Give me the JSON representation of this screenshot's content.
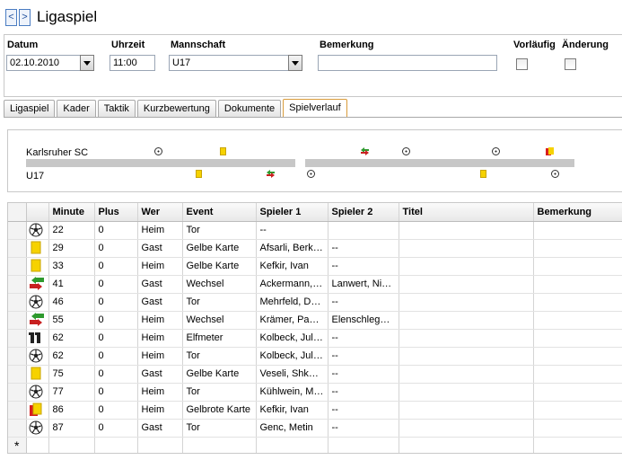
{
  "header": {
    "prev_label": "<",
    "next_label": ">",
    "title": "Ligaspiel"
  },
  "filters": {
    "datum_label": "Datum",
    "datum_value": "02.10.2010",
    "uhrzeit_label": "Uhrzeit",
    "uhrzeit_value": "11:00",
    "mannschaft_label": "Mannschaft",
    "mannschaft_value": "U17",
    "bemerkung_label": "Bemerkung",
    "bemerkung_value": "",
    "vorlaeufig_label": "Vorläufig",
    "aenderung_label": "Änderung"
  },
  "tabs": [
    {
      "label": "Ligaspiel",
      "active": false
    },
    {
      "label": "Kader",
      "active": false
    },
    {
      "label": "Taktik",
      "active": false
    },
    {
      "label": "Kurzbewertung",
      "active": false
    },
    {
      "label": "Dokumente",
      "active": false
    },
    {
      "label": "Spielverlauf",
      "active": true
    }
  ],
  "timeline": {
    "home_team": "Karlsruher SC",
    "away_team": "U17"
  },
  "table": {
    "columns": [
      "Minute",
      "Plus",
      "Wer",
      "Event",
      "Spieler 1",
      "Spieler 2",
      "Titel",
      "Bemerkung"
    ],
    "rows": [
      {
        "icon": "soccer-ball-icon",
        "minute": "22",
        "plus": "0",
        "wer": "Heim",
        "event": "Tor",
        "spieler1": "--",
        "spieler2": "",
        "titel": "",
        "bemerkung": ""
      },
      {
        "icon": "yellow-card-icon",
        "minute": "29",
        "plus": "0",
        "wer": "Gast",
        "event": "Gelbe Karte",
        "spieler1": "Afsarli, Berkan",
        "spieler2": "--",
        "titel": "",
        "bemerkung": ""
      },
      {
        "icon": "yellow-card-icon",
        "minute": "33",
        "plus": "0",
        "wer": "Heim",
        "event": "Gelbe Karte",
        "spieler1": "Kefkir, Ivan",
        "spieler2": "--",
        "titel": "",
        "bemerkung": ""
      },
      {
        "icon": "substitution-icon",
        "minute": "41",
        "plus": "0",
        "wer": "Gast",
        "event": "Wechsel",
        "spieler1": "Ackermann, J...",
        "spieler2": "Lanwert, Nic...",
        "titel": "",
        "bemerkung": ""
      },
      {
        "icon": "soccer-ball-icon",
        "minute": "46",
        "plus": "0",
        "wer": "Gast",
        "event": "Tor",
        "spieler1": "Mehrfeld, Dan...",
        "spieler2": "--",
        "titel": "",
        "bemerkung": ""
      },
      {
        "icon": "substitution-icon",
        "minute": "55",
        "plus": "0",
        "wer": "Heim",
        "event": "Wechsel",
        "spieler1": "Krämer, Pascal",
        "spieler2": "Elenschleger,...",
        "titel": "",
        "bemerkung": ""
      },
      {
        "icon": "penalty-11-icon",
        "minute": "62",
        "plus": "0",
        "wer": "Heim",
        "event": "Elfmeter",
        "spieler1": "Kolbeck, Julian",
        "spieler2": "--",
        "titel": "",
        "bemerkung": ""
      },
      {
        "icon": "soccer-ball-icon",
        "minute": "62",
        "plus": "0",
        "wer": "Heim",
        "event": "Tor",
        "spieler1": "Kolbeck, Julian",
        "spieler2": "--",
        "titel": "",
        "bemerkung": ""
      },
      {
        "icon": "yellow-card-icon",
        "minute": "75",
        "plus": "0",
        "wer": "Gast",
        "event": "Gelbe Karte",
        "spieler1": "Veseli, Shkel...",
        "spieler2": "--",
        "titel": "",
        "bemerkung": ""
      },
      {
        "icon": "soccer-ball-icon",
        "minute": "77",
        "plus": "0",
        "wer": "Heim",
        "event": "Tor",
        "spieler1": "Kühlwein, Ma...",
        "spieler2": "--",
        "titel": "",
        "bemerkung": ""
      },
      {
        "icon": "yellow-red-card-icon",
        "minute": "86",
        "plus": "0",
        "wer": "Heim",
        "event": "Gelbrote Karte",
        "spieler1": "Kefkir, Ivan",
        "spieler2": "--",
        "titel": "",
        "bemerkung": ""
      },
      {
        "icon": "soccer-ball-icon",
        "minute": "87",
        "plus": "0",
        "wer": "Gast",
        "event": "Tor",
        "spieler1": "Genc, Metin",
        "spieler2": "--",
        "titel": "",
        "bemerkung": ""
      }
    ],
    "new_row_marker": "*"
  },
  "colors": {
    "yellow_card": "#f6d200",
    "red_card": "#d81e1e",
    "sub_green": "#2e9a2e",
    "sub_red": "#c82020",
    "active_tab_border": "#d99c3c",
    "nav_button_border": "#4a7cc2"
  }
}
